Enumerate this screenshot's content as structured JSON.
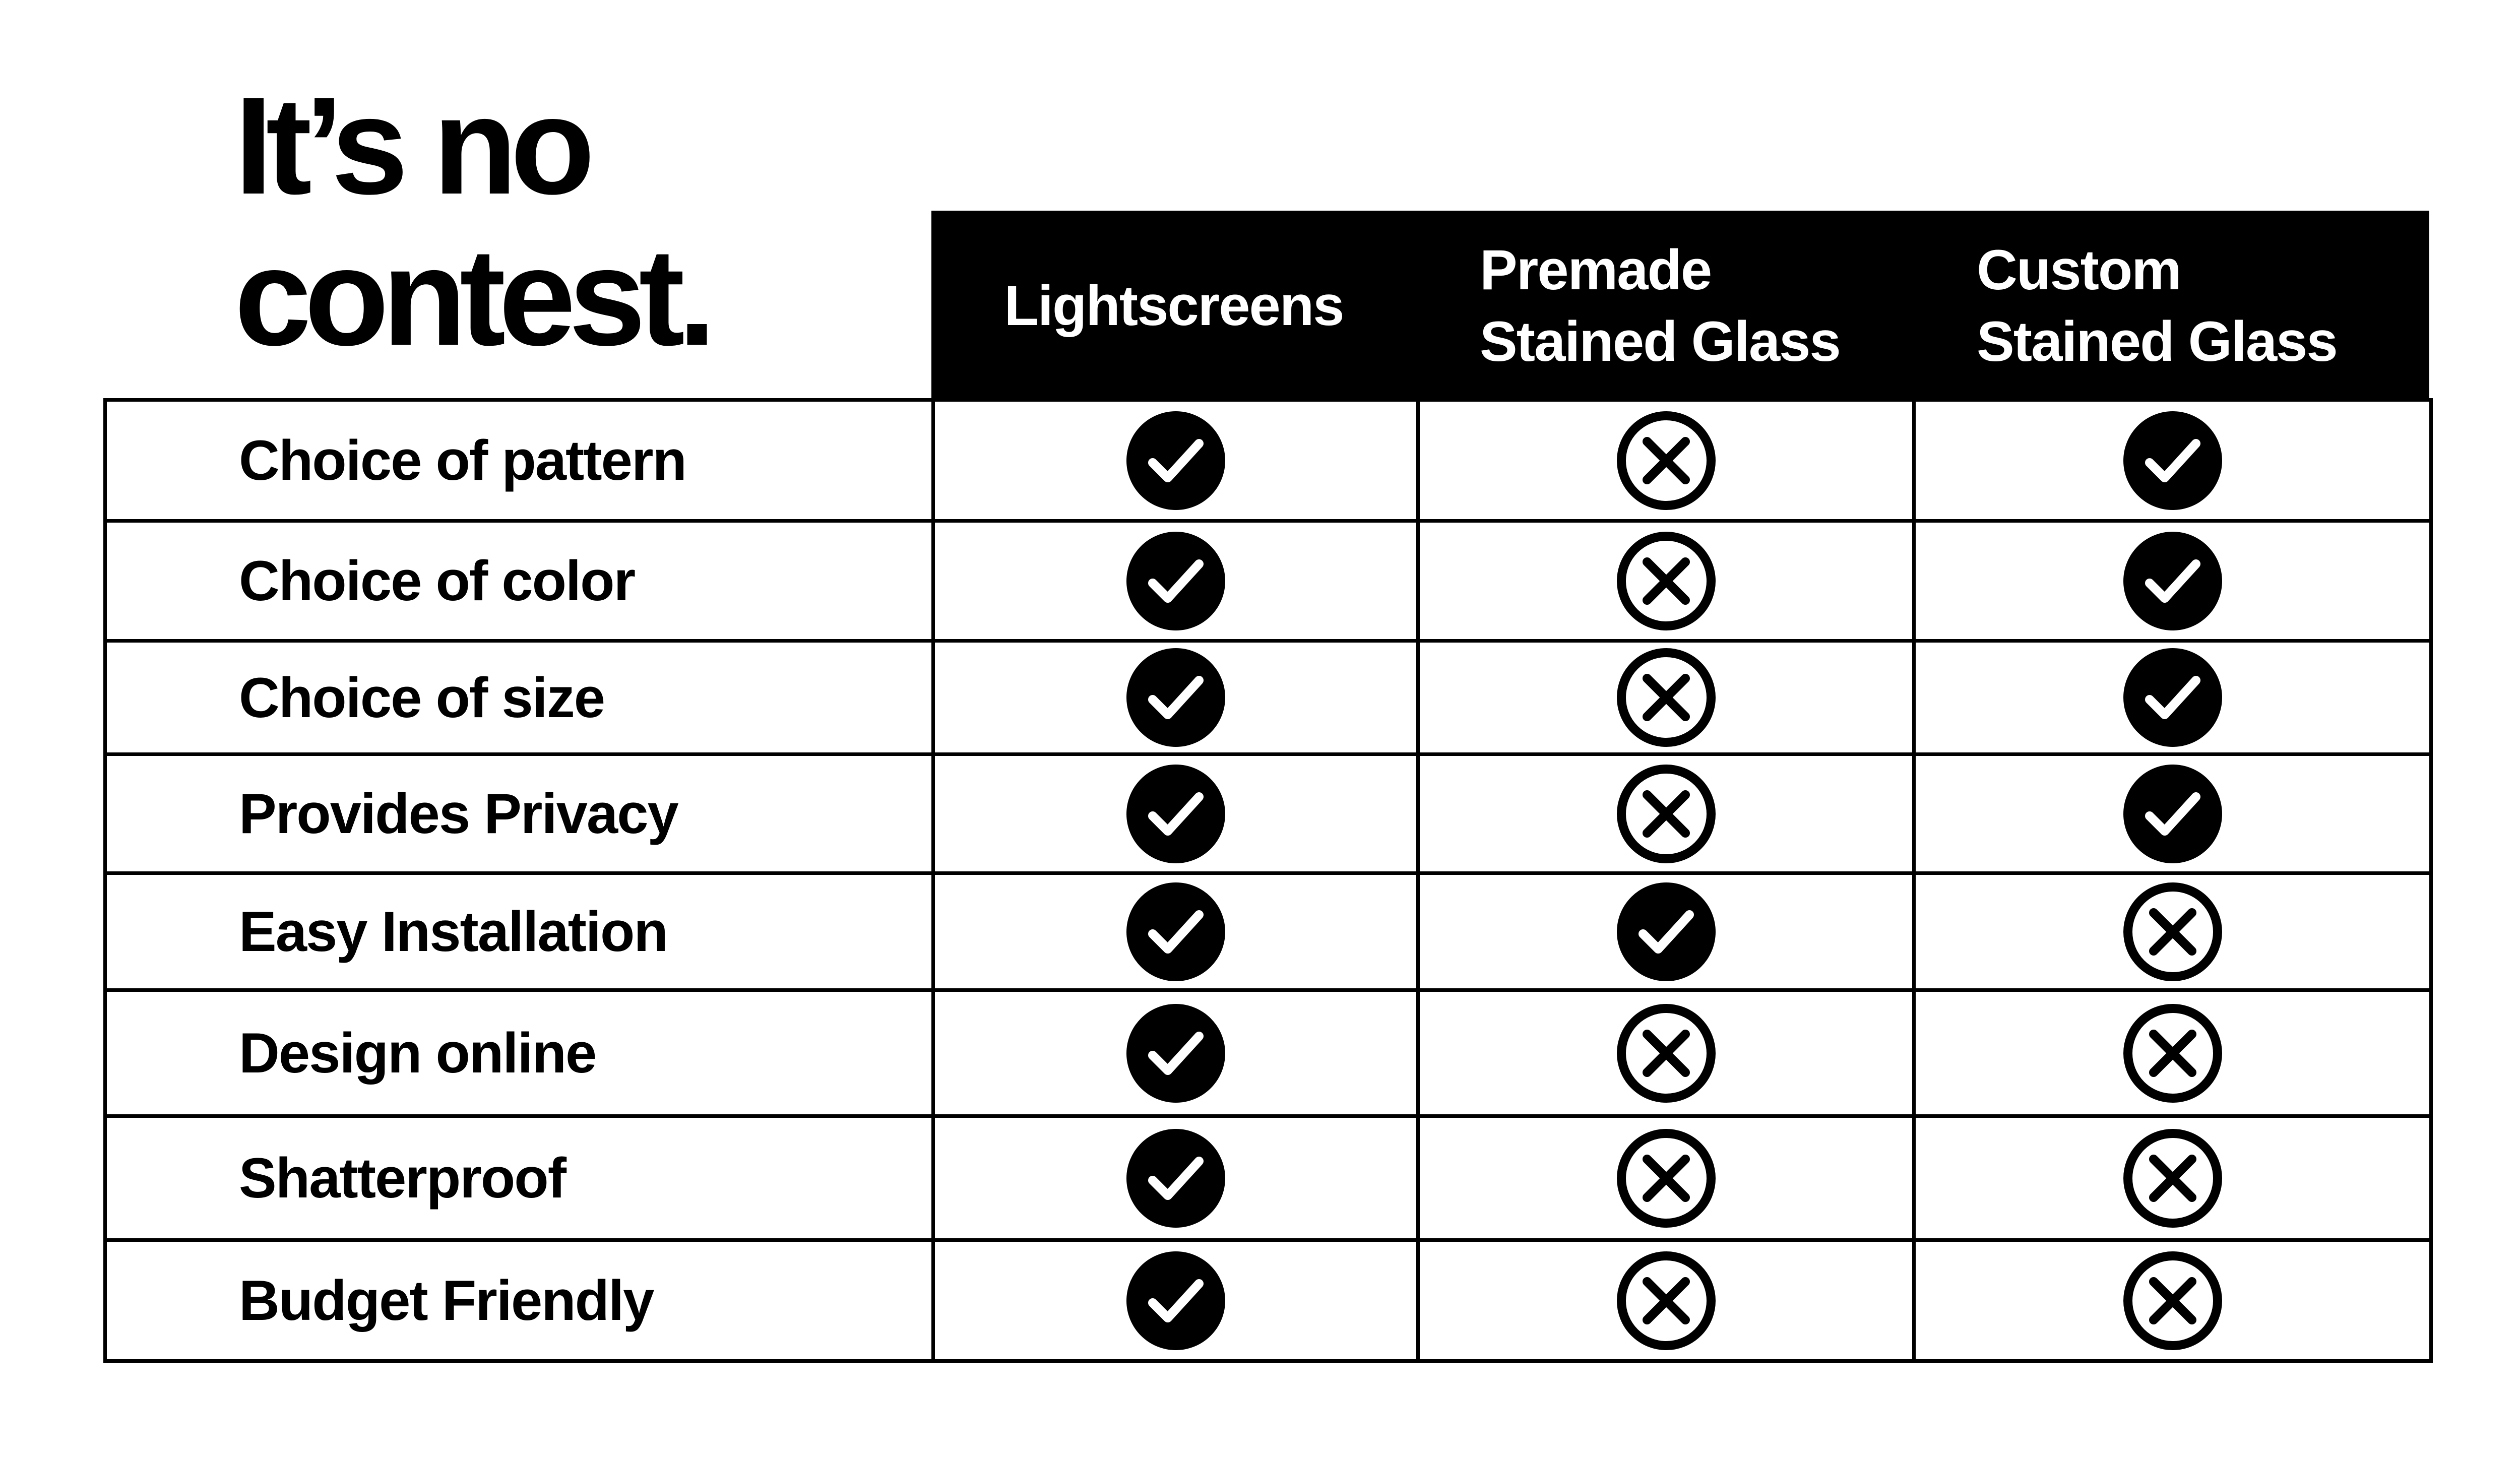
{
  "title": {
    "line1": "It’s no",
    "line2": "contest."
  },
  "columns": [
    "Lightscreens",
    "Premade\nStained Glass",
    "Custom\nStained Glass"
  ],
  "rows": [
    {
      "feature": "Choice of pattern",
      "values": [
        "check",
        "cross",
        "check"
      ]
    },
    {
      "feature": "Choice of color",
      "values": [
        "check",
        "cross",
        "check"
      ]
    },
    {
      "feature": "Choice of size",
      "values": [
        "check",
        "cross",
        "check"
      ]
    },
    {
      "feature": "Provides Privacy",
      "values": [
        "check",
        "cross",
        "check"
      ]
    },
    {
      "feature": "Easy Installation",
      "values": [
        "check",
        "check",
        "cross"
      ]
    },
    {
      "feature": "Design online",
      "values": [
        "check",
        "cross",
        "cross"
      ]
    },
    {
      "feature": "Shatterproof",
      "values": [
        "check",
        "cross",
        "cross"
      ]
    },
    {
      "feature": "Budget Friendly",
      "values": [
        "check",
        "cross",
        "cross"
      ]
    }
  ],
  "icons": {
    "check": "check-circle-icon",
    "cross": "x-circle-icon"
  },
  "colors": {
    "background": "#ffffff",
    "ink": "#000000"
  }
}
